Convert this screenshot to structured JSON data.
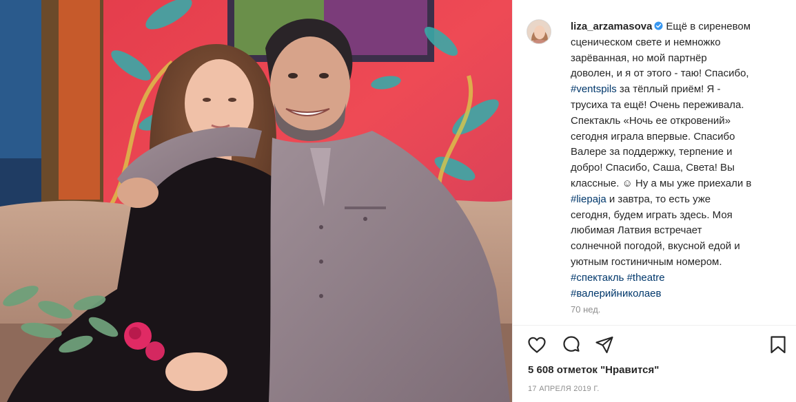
{
  "post": {
    "username": "liza_arzamasova",
    "caption_lines": [
      "Ещё в сиреневом",
      "сценическом свете и немножко",
      "зарёванная, но мой партнёр",
      "доволен, и я от этого - таю! Спасибо,",
      "за тёплый приём! Я -",
      "трусиха та ещё! Очень переживала.",
      "Спектакль «Ночь ее откровений»",
      "сегодня играла впервые. Спасибо",
      "Валере за поддержку, терпение и",
      "добро! Спасибо, Саша, Света! Вы",
      "классные. ☺ Ну а мы уже приехали в",
      "и завтра, то есть уже",
      "сегодня, будем играть здесь. Моя",
      "любимая Латвия встречает",
      "солнечной погодой, вкусной едой и",
      "уютным гостиничным номером."
    ],
    "hashtags": {
      "ventspils": "#ventspils",
      "liepaja": "#liepaja",
      "spektakl": "#спектакль",
      "theatre": "#theatre",
      "nikolaev": "#валерийниколаев"
    },
    "time_ago": "70 нед.",
    "likes": "5 608 отметок \"Нравится\"",
    "date": "17 АПРЕЛЯ 2019 Г."
  },
  "icons": {
    "like": "heart-icon",
    "comment": "comment-icon",
    "share": "paper-plane-icon",
    "save": "bookmark-icon",
    "verified": "verified-badge-icon"
  },
  "colors": {
    "text": "#262626",
    "secondary": "#8e8e8e",
    "link": "#00376b",
    "verified": "#3897f0"
  }
}
